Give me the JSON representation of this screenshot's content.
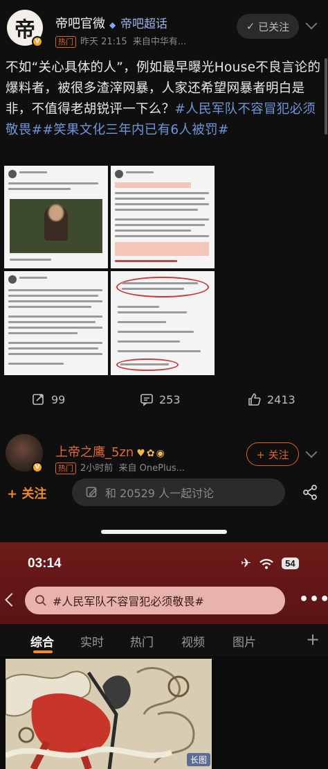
{
  "post": {
    "author_name": "帝吧官微",
    "supertopic_label": "帝吧超话",
    "hot_tag": "热门",
    "time": "昨天 21:15",
    "source": "来自中华有...",
    "followed_label": "已关注",
    "text_plain": "不如“关心具体的人”，例如最早曝光House不良言论的爆料者，被很多渣滓网暴，人家还希望网暴者明白是非，不值得老胡锐评一下么？",
    "hashtag1": "#人民军队不容冒犯必须敬畏#",
    "hashtag2": "#笑果文化三年内已有6人被罚#",
    "avatar_glyph": "帝"
  },
  "actions": {
    "reposts": "99",
    "comments": "253",
    "likes": "2413"
  },
  "second_post": {
    "author_name": "上帝之鹰_5zn",
    "hot_tag": "热门",
    "time": "2小时前",
    "source": "来自 OnePlus...",
    "follow_label": "+ 关注"
  },
  "bottom_bar": {
    "follow_label": "+ 关注",
    "discuss_placeholder": "和 20529 人一起讨论"
  },
  "phone2": {
    "clock": "03:14",
    "battery": "54",
    "search_text": "#人民军队不容冒犯必须敬畏#",
    "tabs": [
      {
        "label": "综合",
        "active": true
      },
      {
        "label": "实时",
        "active": false
      },
      {
        "label": "热门",
        "active": false
      },
      {
        "label": "视频",
        "active": false
      },
      {
        "label": "图片",
        "active": false
      }
    ],
    "long_image_badge": "长图"
  },
  "colors": {
    "accent_orange": "#f08a2e",
    "hashtag_blue": "#6f95d8",
    "header_red": "#6e1a1a",
    "search_pink": "#e8b3ad"
  },
  "icons": [
    "verified-badge-icon",
    "diamond-icon",
    "chevron-down-icon",
    "repost-icon",
    "comment-icon",
    "like-icon",
    "edit-icon",
    "share-icon",
    "airplane-icon",
    "wifi-icon",
    "battery-icon",
    "back-arrow-icon",
    "search-icon",
    "more-icon",
    "plus-icon"
  ]
}
